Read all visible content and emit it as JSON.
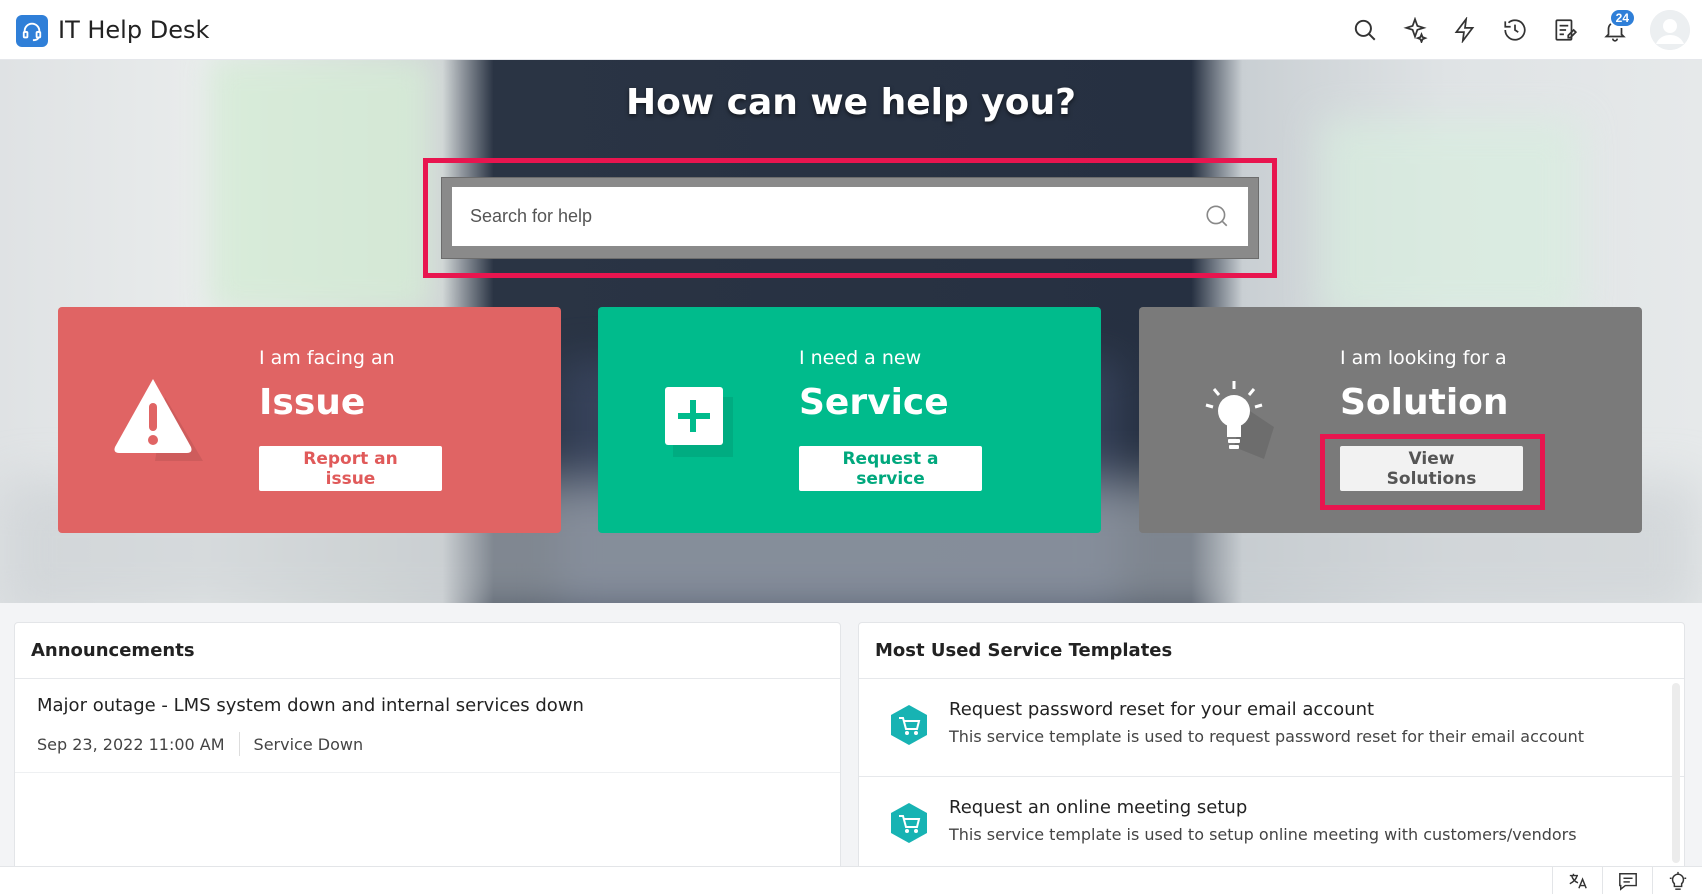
{
  "app": {
    "title": "IT Help Desk",
    "logo_icon": "headset-icon",
    "accent": "#2f7fd8"
  },
  "topbar": {
    "icons": [
      "search-icon",
      "sparkle-icon",
      "bolt-icon",
      "history-icon",
      "notes-icon",
      "bell-icon",
      "avatar"
    ],
    "notification_count": "24"
  },
  "hero": {
    "title": "How can we help you?",
    "search": {
      "placeholder": "Search for help",
      "value": ""
    }
  },
  "cards": [
    {
      "subtitle": "I am facing an",
      "title": "Issue",
      "button": "Report an issue",
      "icon": "warning-icon",
      "color": "#e06464"
    },
    {
      "subtitle": "I need a new",
      "title": "Service",
      "button": "Request a service",
      "icon": "plus-icon",
      "color": "#00bb8c"
    },
    {
      "subtitle": "I am looking for a",
      "title": "Solution",
      "button": "View Solutions",
      "icon": "lightbulb-icon",
      "color": "#7a7a7a"
    }
  ],
  "announcements": {
    "header": "Announcements",
    "items": [
      {
        "title": "Major outage - LMS system down and internal services down",
        "date": "Sep 23, 2022 11:00 AM",
        "category": "Service Down"
      }
    ]
  },
  "templates": {
    "header": "Most Used Service Templates",
    "items": [
      {
        "title": "Request password reset for your email account",
        "desc": "This service template is used to request password reset for their email account",
        "icon": "cart-icon"
      },
      {
        "title": "Request an online meeting setup",
        "desc": "This service template is used to setup online meeting with customers/vendors",
        "icon": "cart-icon"
      }
    ]
  },
  "bottombar": {
    "icons": [
      "translate-icon",
      "chat-icon",
      "lightbulb-icon"
    ]
  },
  "highlight_color": "#e8154f"
}
